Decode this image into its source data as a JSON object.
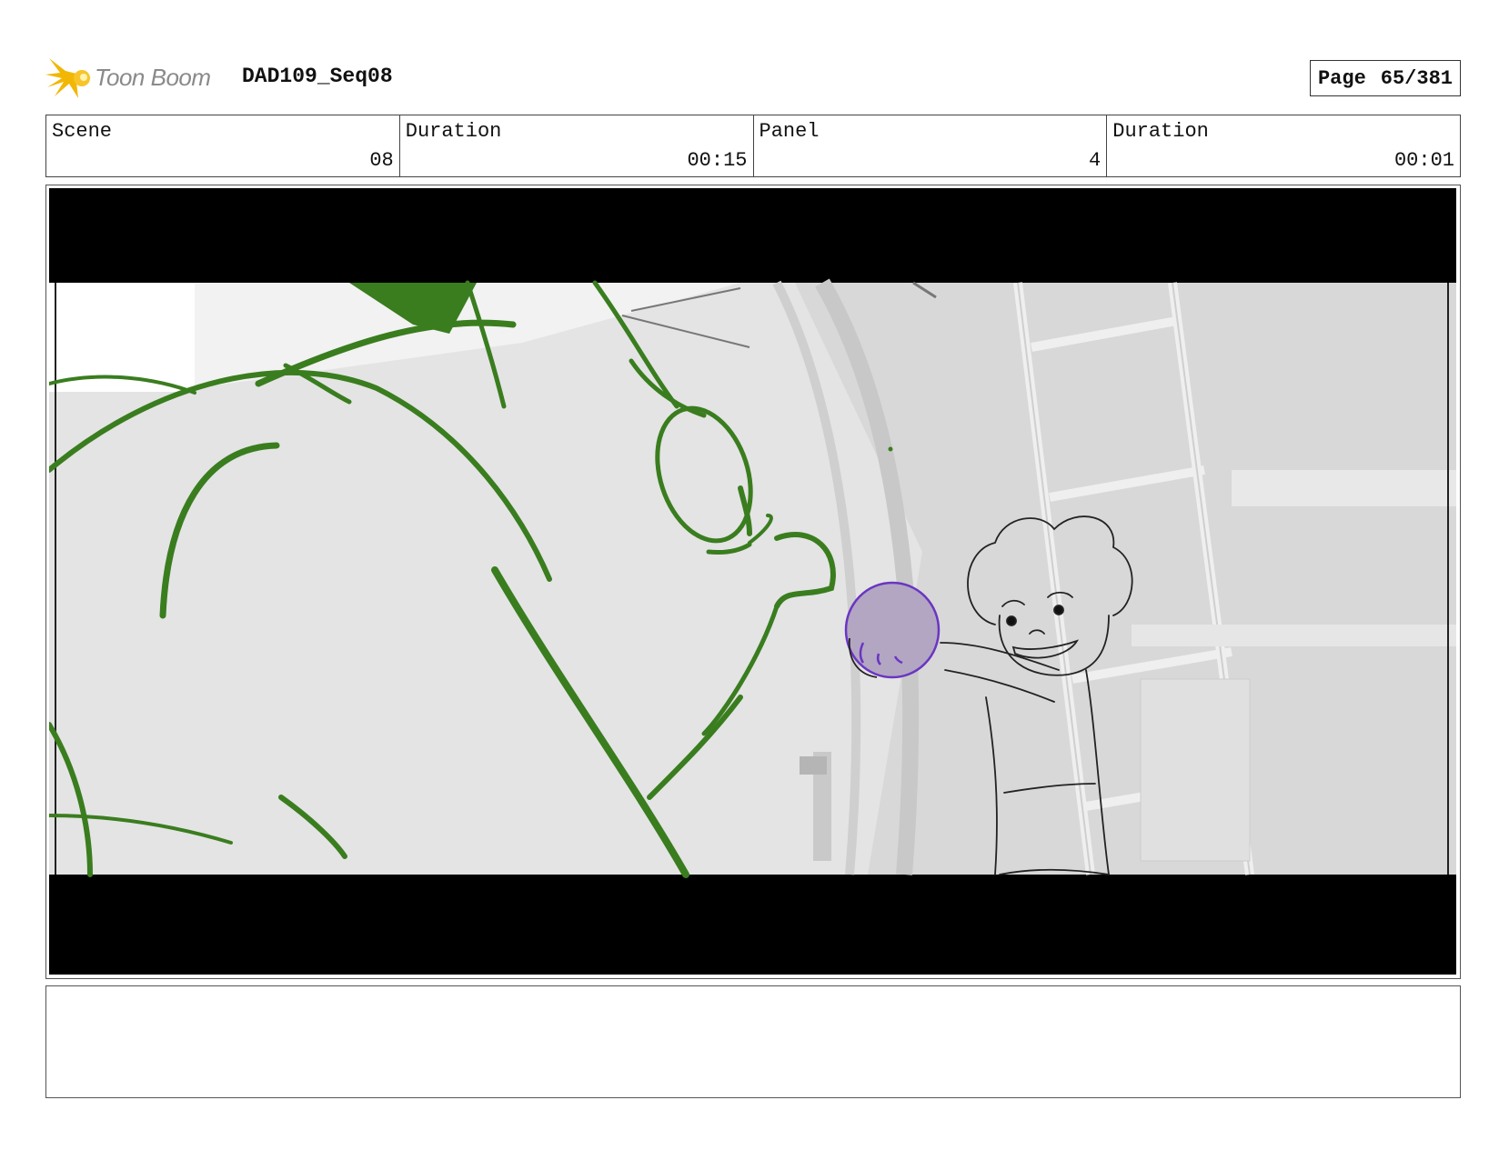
{
  "header": {
    "logo_text": "Toon Boom",
    "logo_icon": "toon-boom-burst-icon",
    "title": "DAD109_Seq08",
    "page_label": "Page",
    "page_value": "65/381"
  },
  "info": {
    "scene_label": "Scene",
    "scene_value": "08",
    "scene_duration_label": "Duration",
    "scene_duration_value": "00:15",
    "panel_label": "Panel",
    "panel_value": "4",
    "panel_duration_label": "Duration",
    "panel_duration_value": "00:01"
  },
  "colors": {
    "sketch_green": "#3a7d1f",
    "orb_purple": "#6a35c2",
    "orb_fill": "#b2a6c2",
    "letterbox": "#000000"
  },
  "notes": {
    "text": ""
  }
}
